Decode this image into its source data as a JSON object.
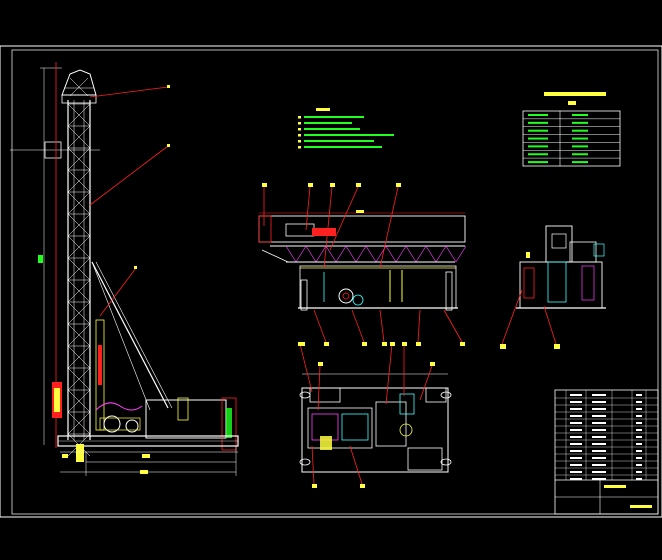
{
  "colors": {
    "background": "#000000",
    "frame": "#ffffff",
    "leader": "#ff2020",
    "structure": "#ffffff",
    "accent_yellow": "#ffff40",
    "accent_green": "#20ff20",
    "accent_cyan": "#40ffff",
    "accent_magenta": "#ff40ff",
    "accent_blue": "#4060ff"
  },
  "drawing": {
    "title": "",
    "tech_requirements_heading": "",
    "spec_table_title": ""
  }
}
